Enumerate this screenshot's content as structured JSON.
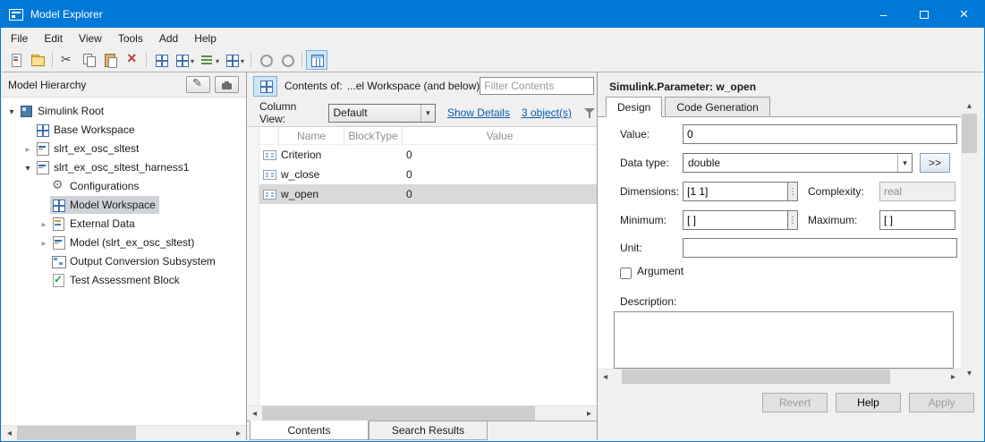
{
  "window": {
    "title": "Model Explorer"
  },
  "menu": {
    "items": [
      "File",
      "Edit",
      "View",
      "Tools",
      "Add",
      "Help"
    ]
  },
  "hierarchy": {
    "title": "Model Hierarchy",
    "items": [
      {
        "label": "Simulink Root",
        "level": 0,
        "state": "expanded",
        "selected": false
      },
      {
        "label": "Base Workspace",
        "level": 1,
        "state": "leaf",
        "selected": false
      },
      {
        "label": "slrt_ex_osc_sltest",
        "level": 1,
        "state": "collapsed",
        "selected": false
      },
      {
        "label": "slrt_ex_osc_sltest_harness1",
        "level": 1,
        "state": "expanded",
        "selected": false
      },
      {
        "label": "Configurations",
        "level": 2,
        "state": "leaf",
        "selected": false
      },
      {
        "label": "Model Workspace",
        "level": 2,
        "state": "leaf",
        "selected": true
      },
      {
        "label": "External Data",
        "level": 2,
        "state": "collapsed",
        "selected": false
      },
      {
        "label": "Model (slrt_ex_osc_sltest)",
        "level": 2,
        "state": "collapsed",
        "selected": false
      },
      {
        "label": "Output Conversion Subsystem",
        "level": 2,
        "state": "leaf",
        "selected": false
      },
      {
        "label": "Test Assessment Block",
        "level": 2,
        "state": "leaf",
        "selected": false
      }
    ]
  },
  "contents": {
    "header_prefix": "Contents of:",
    "header_path": "...el Workspace  (and below)",
    "filter_placeholder": "Filter Contents",
    "column_view_label": "Column View:",
    "column_view_value": "Default",
    "show_details_link": "Show Details",
    "object_count_link": "3 object(s)",
    "table": {
      "columns": [
        "Name",
        "BlockType",
        "Value"
      ],
      "rows": [
        {
          "name": "Criterion",
          "blocktype": "",
          "value": "0",
          "selected": false
        },
        {
          "name": "w_close",
          "blocktype": "",
          "value": "0",
          "selected": false
        },
        {
          "name": "w_open",
          "blocktype": "",
          "value": "0",
          "selected": true
        }
      ]
    },
    "tabs": [
      "Contents",
      "Search Results"
    ]
  },
  "properties": {
    "title": "Simulink.Parameter: w_open",
    "tabs": [
      "Design",
      "Code Generation"
    ],
    "fields": {
      "value_label": "Value:",
      "value": "0",
      "data_type_label": "Data type:",
      "data_type": "double",
      "expand_button": ">>",
      "dimensions_label": "Dimensions:",
      "dimensions": "[1 1]",
      "complexity_label": "Complexity:",
      "complexity": "real",
      "minimum_label": "Minimum:",
      "minimum": "[ ]",
      "maximum_label": "Maximum:",
      "maximum": "[ ]",
      "unit_label": "Unit:",
      "unit": "",
      "argument_label": "Argument",
      "description_label": "Description:",
      "description": ""
    },
    "buttons": {
      "revert": "Revert",
      "help": "Help",
      "apply": "Apply"
    }
  }
}
